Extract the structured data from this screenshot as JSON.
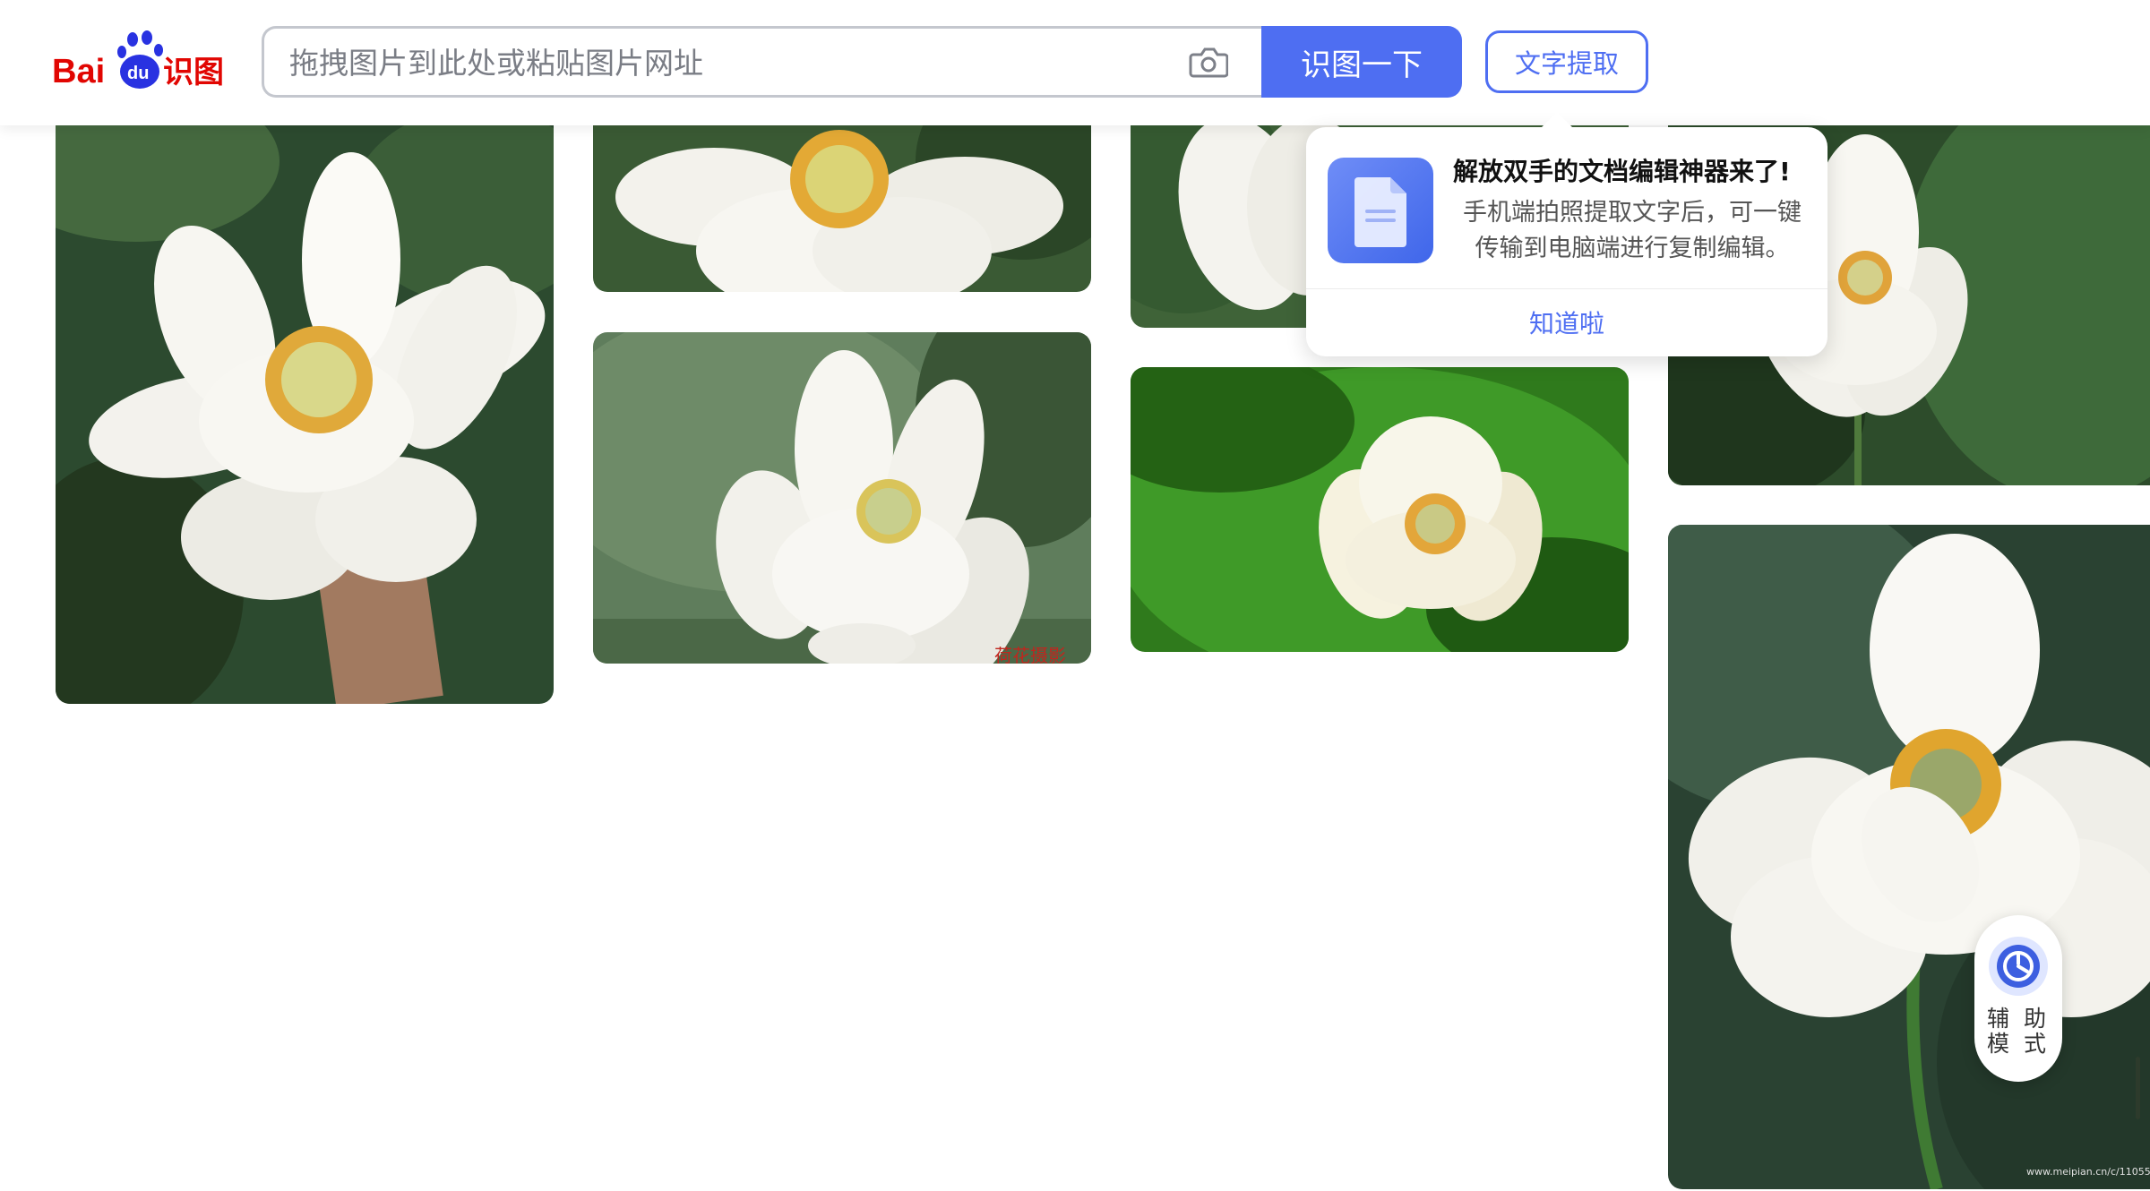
{
  "header": {
    "logo_alt": "Bai du 识图",
    "search": {
      "value": "",
      "placeholder": "拖拽图片到此处或粘贴图片网址"
    },
    "search_button_label": "识图一下",
    "text_extract_label": "文字提取"
  },
  "popover": {
    "title": "解放双手的文档编辑神器来了!",
    "description": "手机端拍照提取文字后，可一键传输到电脑端进行复制编辑。",
    "confirm_label": "知道啦"
  },
  "assist_mode": {
    "label_line1": "辅 助",
    "label_line2": "模 式"
  },
  "watermark_text": "www.meipian.cn/c/11055",
  "colors": {
    "accent": "#4e6ef2",
    "lotus_petal": "#f6f5ef",
    "leaf_green": "#3f6b3a"
  }
}
